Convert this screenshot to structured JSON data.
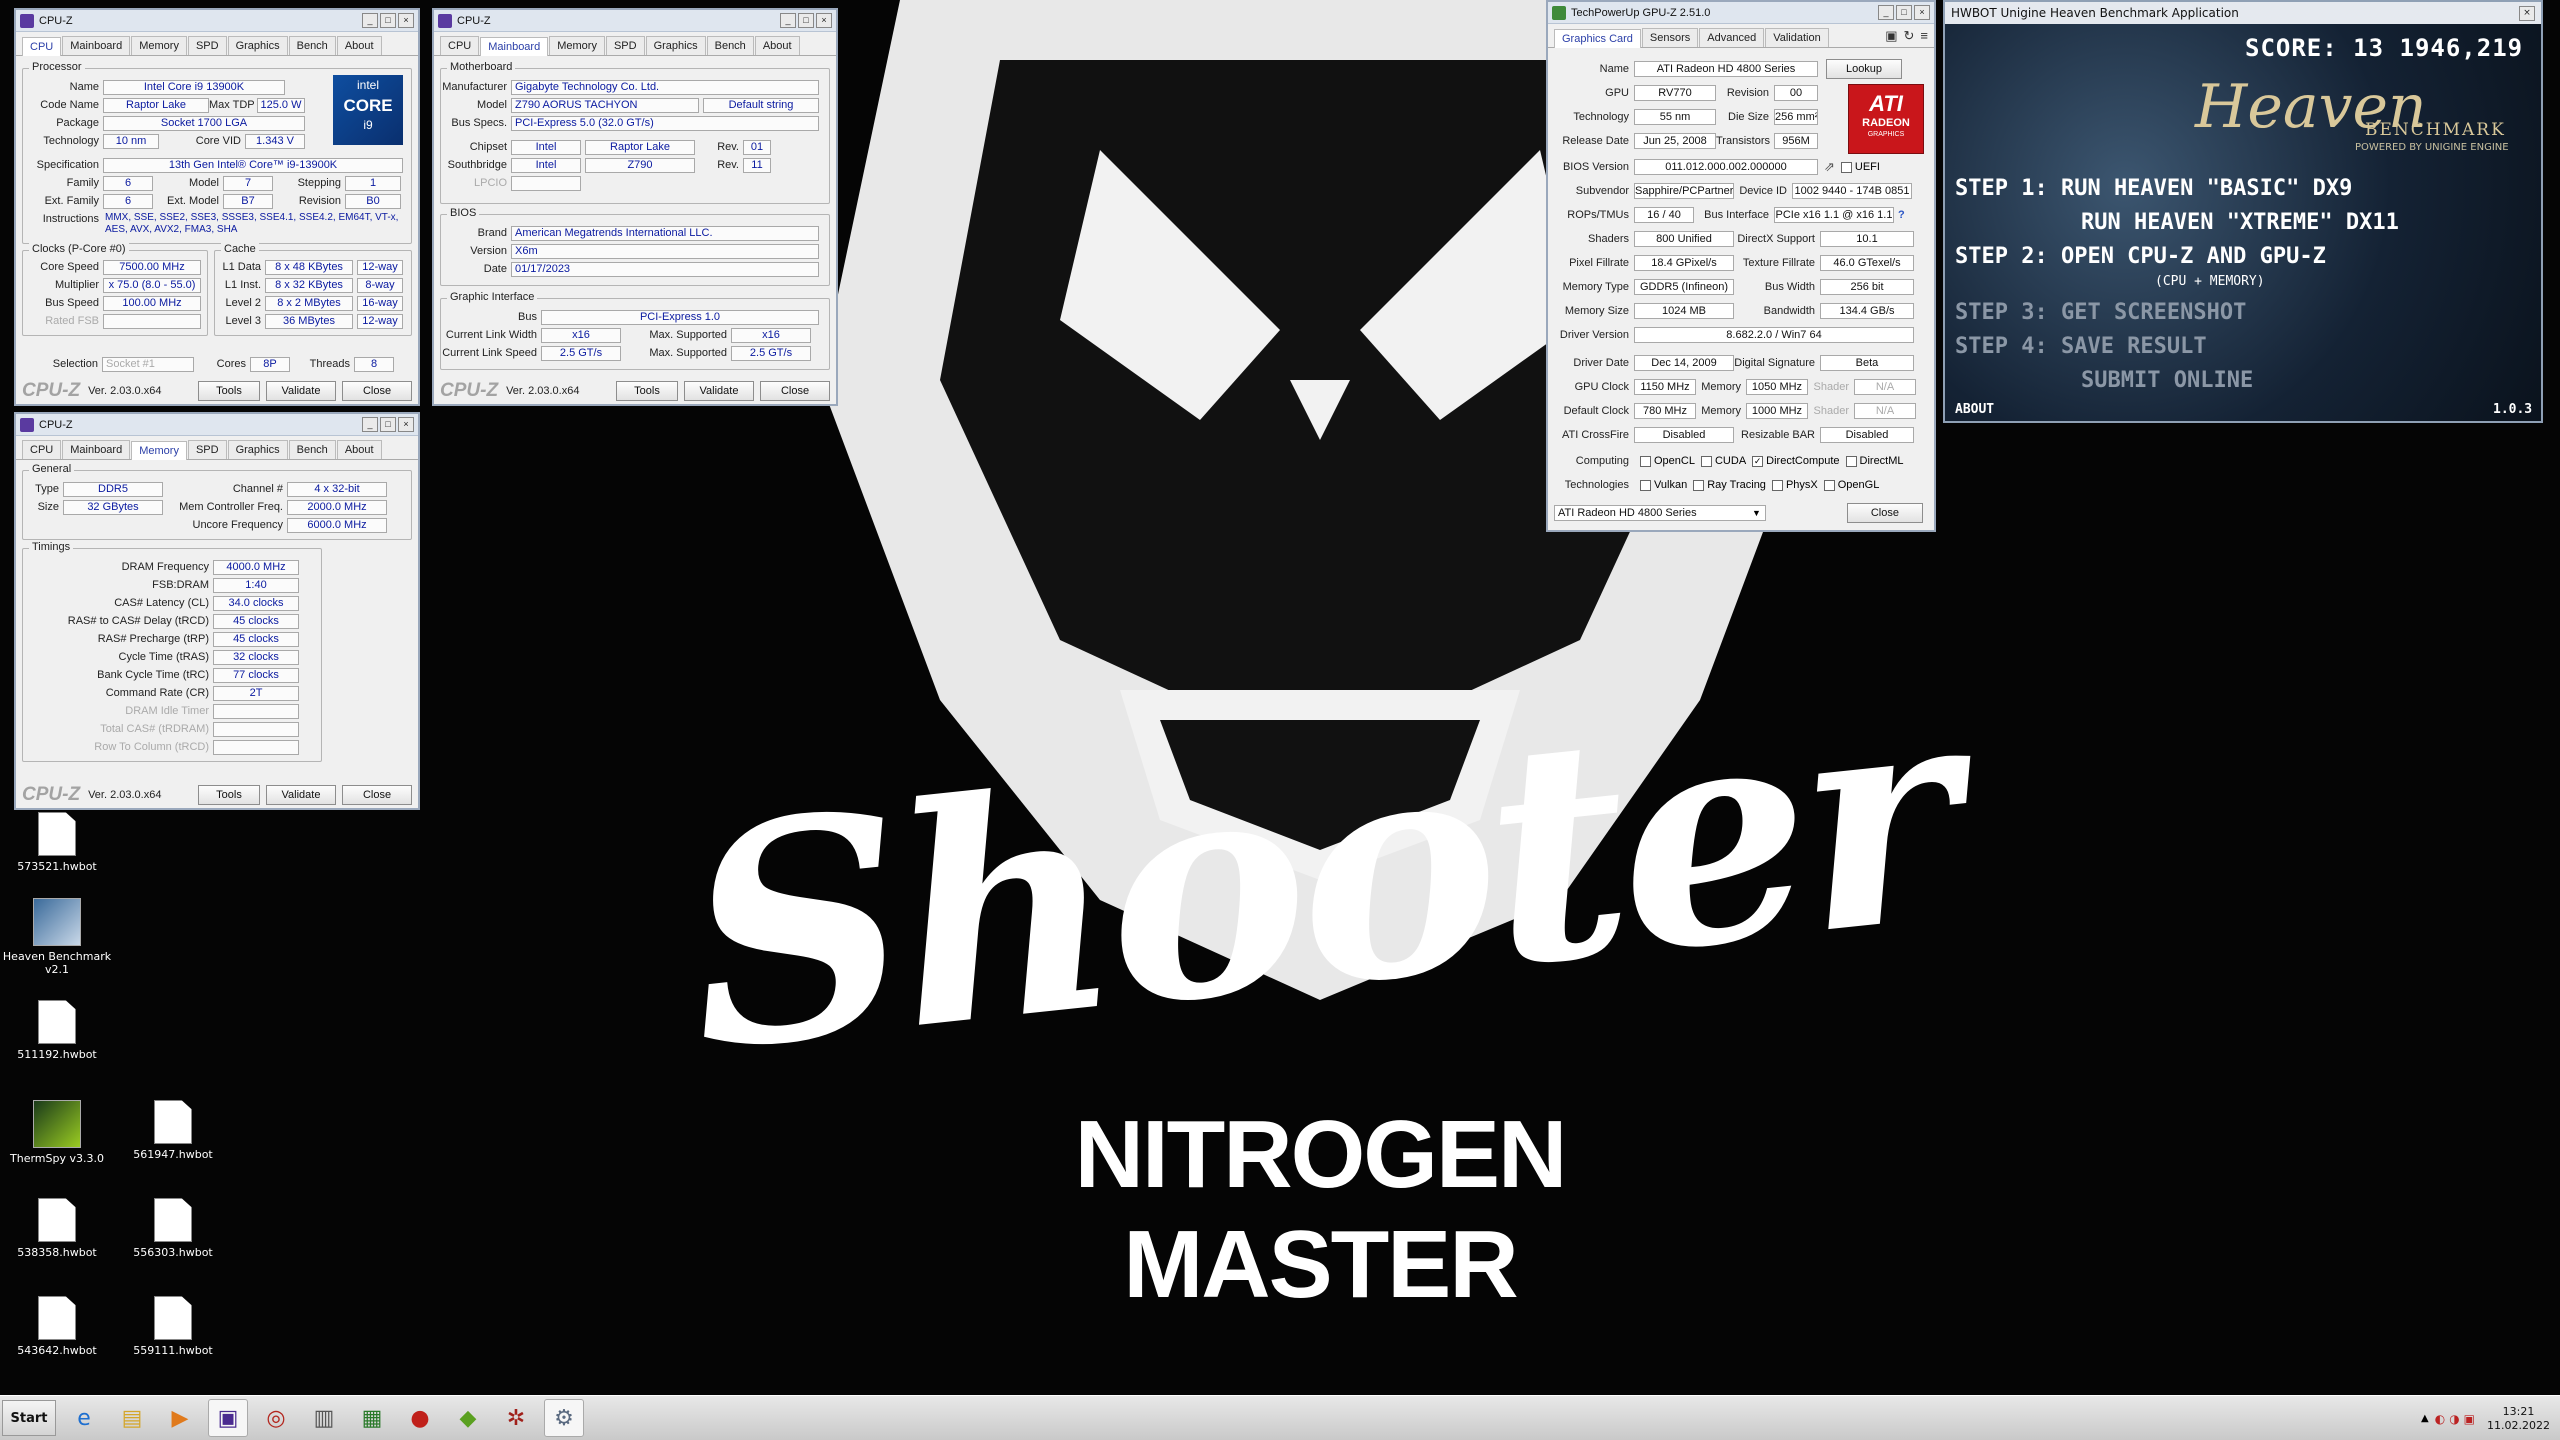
{
  "wallpaper": {
    "logo_text": "Shooter",
    "subtitle": "NITROGEN MASTER"
  },
  "desktop_icons": [
    {
      "label": "573521.hwbot"
    },
    {
      "label": "Heaven Benchmark v2.1"
    },
    {
      "label": "511192.hwbot"
    },
    {
      "label": "ThermSpy v3.3.0"
    },
    {
      "label": "561947.hwbot"
    },
    {
      "label": "538358.hwbot"
    },
    {
      "label": "556303.hwbot"
    },
    {
      "label": "543642.hwbot"
    },
    {
      "label": "559111.hwbot"
    }
  ],
  "cpuz_common": {
    "title": "CPU-Z",
    "brand": "CPU-Z",
    "version": "Ver. 2.03.0.x64",
    "tools": "Tools",
    "validate": "Validate",
    "close": "Close",
    "tabs": [
      "CPU",
      "Mainboard",
      "Memory",
      "SPD",
      "Graphics",
      "Bench",
      "About"
    ]
  },
  "cpu": {
    "processor_group": "Processor",
    "name_lbl": "Name",
    "name": "Intel Core i9 13900K",
    "code_lbl": "Code Name",
    "code": "Raptor Lake",
    "tdp_lbl": "Max TDP",
    "tdp": "125.0 W",
    "package_lbl": "Package",
    "package": "Socket 1700 LGA",
    "tech_lbl": "Technology",
    "tech": "10 nm",
    "vid_lbl": "Core VID",
    "vid": "1.343 V",
    "spec_lbl": "Specification",
    "spec": "13th Gen Intel® Core™ i9-13900K",
    "family_lbl": "Family",
    "family": "6",
    "model_lbl": "Model",
    "model": "7",
    "stepping_lbl": "Stepping",
    "stepping": "1",
    "extfam_lbl": "Ext. Family",
    "extfam": "6",
    "extmodel_lbl": "Ext. Model",
    "extmodel": "B7",
    "revision_lbl": "Revision",
    "revision": "B0",
    "instr_lbl": "Instructions",
    "instr": "MMX, SSE, SSE2, SSE3, SSSE3, SSE4.1, SSE4.2, EM64T, VT-x, AES, AVX, AVX2, FMA3, SHA",
    "clocks_group": "Clocks (P-Core #0)",
    "cache_group": "Cache",
    "speed_lbl": "Core Speed",
    "speed": "7500.00 MHz",
    "mult_lbl": "Multiplier",
    "mult": "x 75.0 (8.0 - 55.0)",
    "bus_lbl": "Bus Speed",
    "bus": "100.00 MHz",
    "fsb_lbl": "Rated FSB",
    "fsb": "",
    "l1d_lbl": "L1 Data",
    "l1d": "8 x 48 KBytes",
    "l1d_w": "12-way",
    "l1i_lbl": "L1 Inst.",
    "l1i": "8 x 32 KBytes",
    "l1i_w": "8-way",
    "l2_lbl": "Level 2",
    "l2": "8 x 2 MBytes",
    "l2_w": "16-way",
    "l3_lbl": "Level 3",
    "l3": "36 MBytes",
    "l3_w": "12-way",
    "sel_lbl": "Selection",
    "sel": "Socket #1",
    "cores_lbl": "Cores",
    "cores": "8P",
    "threads_lbl": "Threads",
    "threads": "8",
    "logo_brand": "intel",
    "logo_core": "CORE",
    "logo_tier": "i9"
  },
  "mainboard": {
    "mb_group": "Motherboard",
    "manu_lbl": "Manufacturer",
    "manu": "Gigabyte Technology Co. Ltd.",
    "model_lbl": "Model",
    "model": "Z790 AORUS TACHYON",
    "model2": "Default string",
    "busspec_lbl": "Bus Specs.",
    "busspec": "PCI-Express 5.0 (32.0 GT/s)",
    "chipset_lbl": "Chipset",
    "chipset": "Intel",
    "chipset2": "Raptor Lake",
    "rev_lbl": "Rev.",
    "chipset_rev": "01",
    "south_lbl": "Southbridge",
    "south": "Intel",
    "south2": "Z790",
    "south_rev": "11",
    "lpcio_lbl": "LPCIO",
    "bios_group": "BIOS",
    "brand_lbl": "Brand",
    "brand": "American Megatrends International LLC.",
    "version_lbl": "Version",
    "version": "X6m",
    "date_lbl": "Date",
    "date": "01/17/2023",
    "gi_group": "Graphic Interface",
    "gbus_lbl": "Bus",
    "gbus": "PCI-Express 1.0",
    "width_lbl": "Current Link Width",
    "width": "x16",
    "maxw_lbl": "Max. Supported",
    "maxw": "x16",
    "lspeed_lbl": "Current Link Speed",
    "lspeed": "2.5 GT/s",
    "maxs_lbl": "Max. Supported",
    "maxs": "2.5 GT/s"
  },
  "memory": {
    "general_group": "General",
    "type_lbl": "Type",
    "type": "DDR5",
    "channel_lbl": "Channel #",
    "channel": "4 x 32-bit",
    "size_lbl": "Size",
    "size": "32 GBytes",
    "mcf_lbl": "Mem Controller Freq.",
    "mcf": "2000.0 MHz",
    "uncore_lbl": "Uncore Frequency",
    "uncore": "6000.0 MHz",
    "timings_group": "Timings",
    "timings": [
      {
        "label": "DRAM Frequency",
        "value": "4000.0 MHz"
      },
      {
        "label": "FSB:DRAM",
        "value": "1:40"
      },
      {
        "label": "CAS# Latency (CL)",
        "value": "34.0 clocks"
      },
      {
        "label": "RAS# to CAS# Delay (tRCD)",
        "value": "45 clocks"
      },
      {
        "label": "RAS# Precharge (tRP)",
        "value": "45 clocks"
      },
      {
        "label": "Cycle Time (tRAS)",
        "value": "32 clocks"
      },
      {
        "label": "Bank Cycle Time (tRC)",
        "value": "77 clocks"
      },
      {
        "label": "Command Rate (CR)",
        "value": "2T"
      },
      {
        "label": "DRAM Idle Timer",
        "value": ""
      },
      {
        "label": "Total CAS# (tRDRAM)",
        "value": ""
      },
      {
        "label": "Row To Column (tRCD)",
        "value": ""
      }
    ]
  },
  "gpuz": {
    "title": "TechPowerUp GPU-Z 2.51.0",
    "tabs": [
      "Graphics Card",
      "Sensors",
      "Advanced",
      "Validation"
    ],
    "name_lbl": "Name",
    "name": "ATI Radeon HD 4800 Series",
    "lookup": "Lookup",
    "gpu_lbl": "GPU",
    "gpu": "RV770",
    "rev_lbl": "Revision",
    "rev": "00",
    "tech_lbl": "Technology",
    "tech": "55 nm",
    "die_lbl": "Die Size",
    "die": "256 mm²",
    "rel_lbl": "Release Date",
    "rel": "Jun 25, 2008",
    "trans_lbl": "Transistors",
    "trans": "956M",
    "bios_lbl": "BIOS Version",
    "bios": "011.012.000.002.000000",
    "uefi": "UEFI",
    "subv_lbl": "Subvendor",
    "subv": "Sapphire/PCPartner",
    "devid_lbl": "Device ID",
    "devid": "1002 9440 - 174B 0851",
    "rops_lbl": "ROPs/TMUs",
    "rops": "16 / 40",
    "busif_lbl": "Bus Interface",
    "busif": "PCIe x16 1.1 @ x16 1.1",
    "help": "?",
    "shaders_lbl": "Shaders",
    "shaders": "800 Unified",
    "dx_lbl": "DirectX Support",
    "dx": "10.1",
    "pix_lbl": "Pixel Fillrate",
    "pix": "18.4 GPixel/s",
    "tex_lbl": "Texture Fillrate",
    "tex": "46.0 GTexel/s",
    "memtype_lbl": "Memory Type",
    "memtype": "GDDR5 (Infineon)",
    "busw_lbl": "Bus Width",
    "busw": "256 bit",
    "memsize_lbl": "Memory Size",
    "memsize": "1024 MB",
    "bw_lbl": "Bandwidth",
    "bw": "134.4 GB/s",
    "drv_lbl": "Driver Version",
    "drv": "8.682.2.0 / Win7 64",
    "drvdate_lbl": "Driver Date",
    "drvdate": "Dec 14, 2009",
    "sig_lbl": "Digital Signature",
    "sig": "Beta",
    "gclk_lbl": "GPU Clock",
    "gclk": "1150 MHz",
    "mem_lbl": "Memory",
    "mclk": "1050 MHz",
    "shader_lbl": "Shader",
    "sh1": "N/A",
    "dclk_lbl": "Default Clock",
    "dclk": "780 MHz",
    "dmclk": "1000 MHz",
    "sh2": "N/A",
    "cf_lbl": "ATI CrossFire",
    "cf": "Disabled",
    "rbar_lbl": "Resizable BAR",
    "rbar": "Disabled",
    "comp_lbl": "Computing",
    "comp": [
      "OpenCL",
      "CUDA",
      "DirectCompute",
      "DirectML"
    ],
    "techs_lbl": "Technologies",
    "techs": [
      "Vulkan",
      "Ray Tracing",
      "PhysX",
      "OpenGL"
    ],
    "select": "ATI Radeon HD 4800 Series",
    "close": "Close",
    "logo_top": "ATI",
    "logo_mid": "RADEON",
    "logo_bot": "GRAPHICS"
  },
  "heaven": {
    "title": "HWBOT Unigine Heaven Benchmark Application",
    "score": "SCORE: 13 1946,219",
    "logo": "Heaven",
    "bench": "BENCHMARK",
    "powered": "POWERED BY UNIGINE ENGINE",
    "step1": "STEP 1:  RUN HEAVEN \"BASIC\" DX9",
    "step1b": "RUN HEAVEN \"XTREME\" DX11",
    "step2": "STEP 2: OPEN CPU-Z  AND  GPU-Z",
    "step2note": "(CPU + MEMORY)",
    "step3": "STEP 3: GET SCREENSHOT",
    "step4": "STEP 4: SAVE RESULT",
    "submit": "SUBMIT ONLINE",
    "about": "ABOUT",
    "version": "1.0.3"
  },
  "taskbar": {
    "start": "Start",
    "time": "13:21",
    "date": "11.02.2022"
  }
}
